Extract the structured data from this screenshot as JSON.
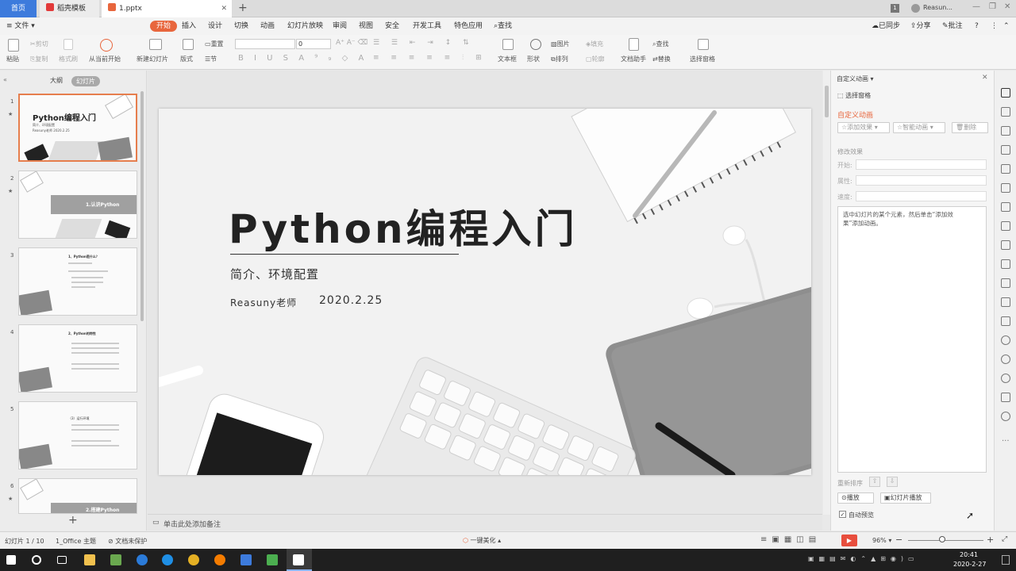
{
  "tabs": {
    "home": "首页",
    "t1": "稻壳模板",
    "t2": "1.pptx",
    "user": "Reasun..."
  },
  "menu": [
    "文件",
    "开始",
    "插入",
    "设计",
    "切换",
    "动画",
    "幻灯片放映",
    "审阅",
    "视图",
    "安全",
    "开发工具",
    "特色应用",
    "查找"
  ],
  "menu_right": {
    "sync": "已同步",
    "share": "分享",
    "comment": "批注"
  },
  "ribbon": {
    "paste": "粘贴",
    "cut": "剪切",
    "copy": "复制",
    "format_painter": "格式刷",
    "play_from_start": "从当前开始",
    "new_slide": "新建幻灯片",
    "layout": "版式",
    "reset": "重置",
    "section": "节",
    "font_size": "0",
    "textbox": "文本框",
    "shape": "形状",
    "arrange": "排列",
    "picture": "图片",
    "fill": "填充",
    "outline": "轮廓",
    "doc_assist": "文档助手",
    "find": "查找",
    "replace": "替换",
    "select_pane": "选择窗格"
  },
  "left": {
    "outline": "大纲",
    "slides": "幻灯片",
    "thumbs": [
      {
        "num": "1",
        "star": "★",
        "title": "Python编程入门",
        "sub": "简介、环境配置",
        "meta": "Reasuny老师  2020.2.25"
      },
      {
        "num": "2",
        "star": "★",
        "title": "1.认识Python"
      },
      {
        "num": "3",
        "star": "",
        "title": "1、Python是什么？"
      },
      {
        "num": "4",
        "star": "",
        "title": "2、Python的特性"
      },
      {
        "num": "5",
        "star": "",
        "title": "（3）运行环境"
      },
      {
        "num": "6",
        "star": "★",
        "title": "2.搭建Python"
      }
    ]
  },
  "slide": {
    "title": "Python编程入门",
    "subtitle": "简介、环境配置",
    "author": "Reasuny老师",
    "date": "2020.2.25"
  },
  "notes_placeholder": "单击此处添加备注",
  "right": {
    "header": "自定义动画",
    "select_pane": "选择窗格",
    "section": "自定义动画",
    "add_effect": "添加效果",
    "smart_anim": "智能动画",
    "delete": "删除",
    "modify": "修改效果",
    "start": "开始:",
    "property": "属性:",
    "speed": "速度:",
    "hint": "选中幻灯片的某个元素，然后单击“添加效果”添加动画。",
    "reorder": "重新排序",
    "play": "播放",
    "slideshow": "幻灯片播放",
    "autopreview": "自动预览"
  },
  "status": {
    "slide_info": "幻灯片 1 / 10",
    "theme": "1_Office 主题",
    "protect": "文档未保护",
    "beautify": "一键美化",
    "zoom": "96%"
  },
  "taskbar": {
    "time": "20:41",
    "date": "2020-2-27"
  },
  "colors": {
    "accent": "#e8663d",
    "tab_blue": "#3d7bdc",
    "taskbar": "#1f1f1f"
  }
}
